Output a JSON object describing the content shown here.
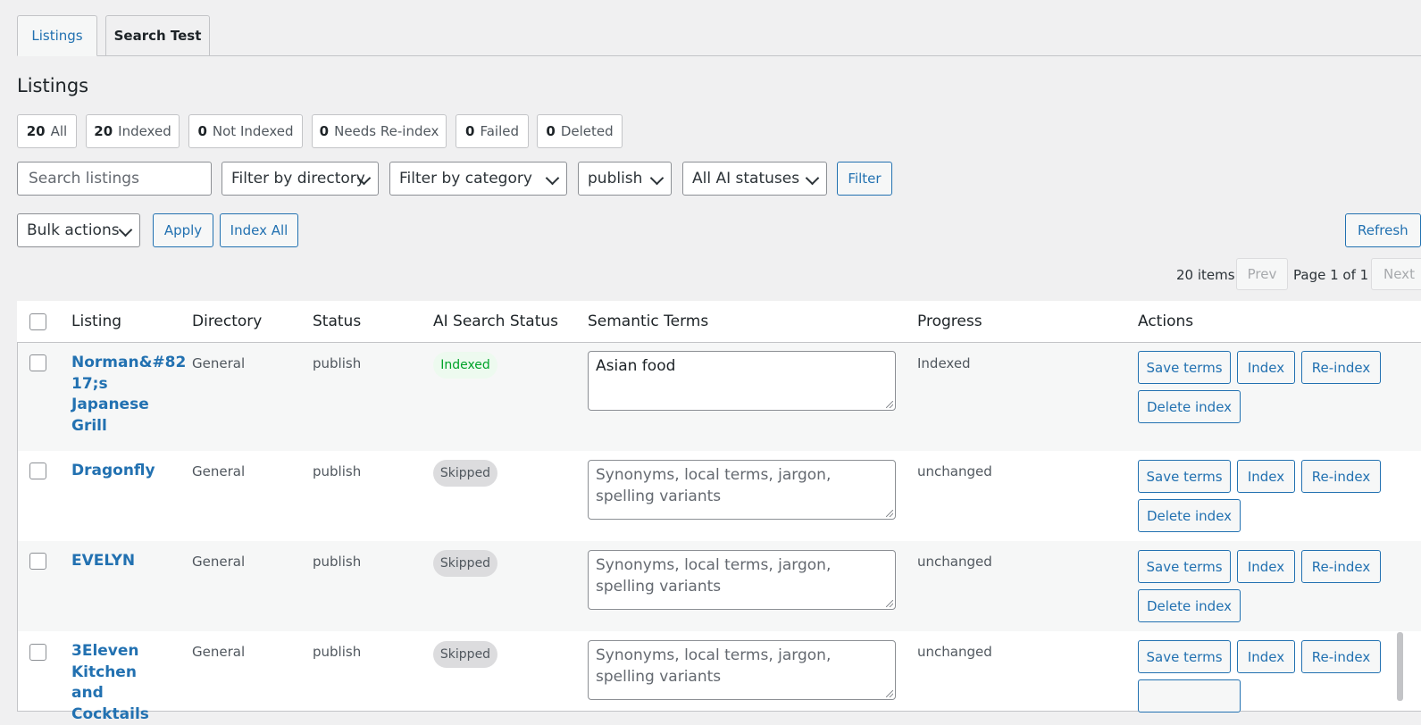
{
  "tabs": [
    {
      "label": "Listings",
      "active": true
    },
    {
      "label": "Search Test",
      "active": false
    }
  ],
  "page_title": "Listings",
  "status_counts": [
    {
      "count": "20",
      "label": "All"
    },
    {
      "count": "20",
      "label": "Indexed"
    },
    {
      "count": "0",
      "label": "Not Indexed"
    },
    {
      "count": "0",
      "label": "Needs Re-index"
    },
    {
      "count": "0",
      "label": "Failed"
    },
    {
      "count": "0",
      "label": "Deleted"
    }
  ],
  "filters": {
    "search_placeholder": "Search listings",
    "directory": "Filter by directory",
    "category": "Filter by category",
    "status": "publish",
    "ai_status": "All AI statuses",
    "filter_button": "Filter"
  },
  "bulk": {
    "bulk_actions": "Bulk actions",
    "apply": "Apply",
    "index_all": "Index All",
    "refresh": "Refresh"
  },
  "pagination": {
    "items": "20 items",
    "prev": "Prev",
    "page_info": "Page 1 of 1",
    "next": "Next"
  },
  "columns": [
    "Listing",
    "Directory",
    "Status",
    "AI Search Status",
    "Semantic Terms",
    "Progress",
    "Actions"
  ],
  "terms_placeholder": "Synonyms, local terms, jargon, spelling variants",
  "actions": {
    "save_terms": "Save terms",
    "index": "Index",
    "reindex": "Re-index",
    "delete_index": "Delete index"
  },
  "rows": [
    {
      "name": "Norman&#8217;s Japanese Grill",
      "directory": "General",
      "status": "publish",
      "ai_status": "Indexed",
      "terms": "Asian food",
      "progress": "Indexed"
    },
    {
      "name": "Dragonfly",
      "directory": "General",
      "status": "publish",
      "ai_status": "Skipped",
      "terms": "",
      "progress": "unchanged"
    },
    {
      "name": "EVELYN",
      "directory": "General",
      "status": "publish",
      "ai_status": "Skipped",
      "terms": "",
      "progress": "unchanged"
    },
    {
      "name": "3Eleven Kitchen and Cocktails",
      "directory": "General",
      "status": "publish",
      "ai_status": "Skipped",
      "terms": "",
      "progress": "unchanged"
    }
  ],
  "colors": {
    "accent": "#2271b1",
    "indexed_badge_bg": "#edfaef",
    "indexed_badge_text": "#00a32a"
  }
}
